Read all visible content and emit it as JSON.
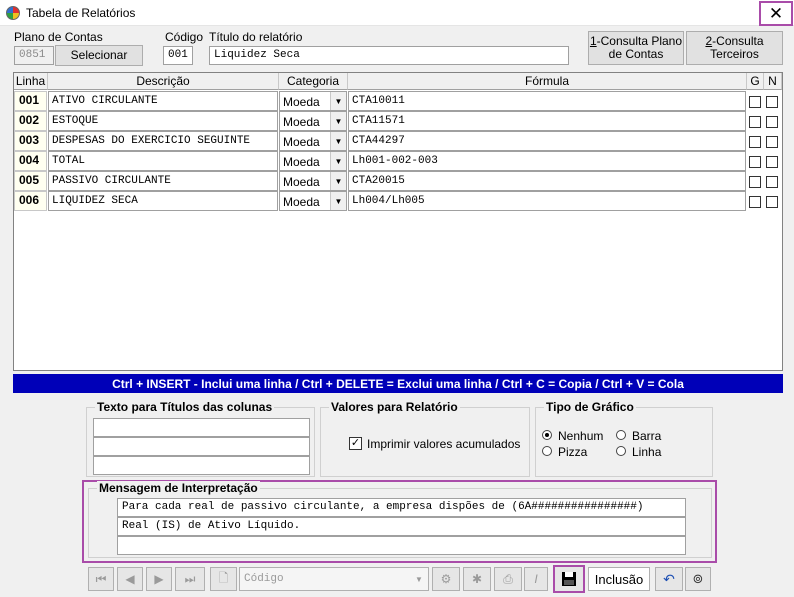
{
  "window": {
    "title": "Tabela de Relatórios",
    "close": "✕"
  },
  "header": {
    "plano_label": "Plano de Contas",
    "plano_value": "0851",
    "select_button": "Selecionar",
    "codigo_label": "Código",
    "codigo_value": "001",
    "titulo_label": "Título do relatório",
    "titulo_value": "Liquidez Seca",
    "btn_consulta_plano_key": "1",
    "btn_consulta_plano_rest": "-Consulta Plano",
    "btn_consulta_plano_line2": "de Contas",
    "btn_consulta_terceiros_key": "2",
    "btn_consulta_terceiros_rest": "-Consulta",
    "btn_consulta_terceiros_line2": "Terceiros"
  },
  "grid": {
    "columns": {
      "linha": "Linha",
      "descricao": "Descrição",
      "categoria": "Categoria",
      "formula": "Fórmula",
      "g": "G",
      "n": "N"
    },
    "rows": [
      {
        "line": "001",
        "desc": "ATIVO CIRCULANTE",
        "cat": "Moeda",
        "formula": "CTA10011"
      },
      {
        "line": "002",
        "desc": "ESTOQUE",
        "cat": "Moeda",
        "formula": "CTA11571"
      },
      {
        "line": "003",
        "desc": "DESPESAS DO EXERCICIO SEGUINTE",
        "cat": "Moeda",
        "formula": "CTA44297"
      },
      {
        "line": "004",
        "desc": "TOTAL",
        "cat": "Moeda",
        "formula": "Lh001-002-003"
      },
      {
        "line": "005",
        "desc": "PASSIVO CIRCULANTE",
        "cat": "Moeda",
        "formula": "CTA20015"
      },
      {
        "line": "006",
        "desc": "LIQUIDEZ SECA",
        "cat": "Moeda",
        "formula": "Lh004/Lh005"
      }
    ]
  },
  "hint": "Ctrl + INSERT - Inclui uma linha  /  Ctrl + DELETE = Exclui uma linha / Ctrl + C = Copia / Ctrl + V = Cola",
  "titles_group": {
    "title": "Texto para Títulos das colunas",
    "lines": [
      "",
      "",
      ""
    ]
  },
  "values_group": {
    "title": "Valores para Relatório",
    "checkbox_label": "Imprimir valores acumulados",
    "checked": true
  },
  "chart_type_group": {
    "title": "Tipo de Gráfico",
    "options": [
      {
        "label": "Nenhum",
        "selected": true
      },
      {
        "label": "Barra",
        "selected": false
      },
      {
        "label": "Pizza",
        "selected": false
      },
      {
        "label": "Linha",
        "selected": false
      }
    ]
  },
  "message_group": {
    "title": "Mensagem de Interpretação",
    "lines": [
      "Para cada real de passivo circulante, a empresa dispões de (6A################)",
      "Real (IS) de Ativo Líquido.",
      ""
    ]
  },
  "toolbar": {
    "search_placeholder": "Código",
    "mode": "Inclusão",
    "italic": "I"
  },
  "colors": {
    "hint_bg": "#0000b8",
    "highlight": "#a94ca9"
  }
}
